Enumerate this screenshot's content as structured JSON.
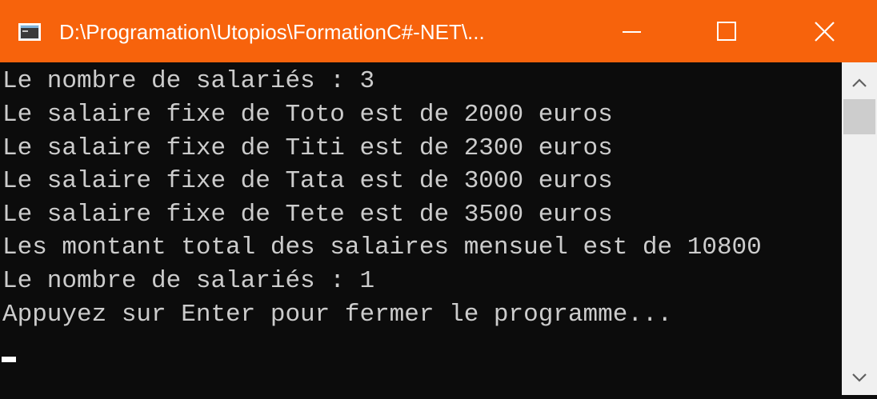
{
  "window": {
    "title": "D:\\Programation\\Utopios\\FormationC#-NET\\...",
    "icon": "console-app-icon",
    "accent_color": "#f7630c",
    "controls": {
      "minimize": "minimize-icon",
      "maximize": "maximize-icon",
      "close": "close-icon"
    }
  },
  "console": {
    "background": "#0c0c0c",
    "text_color": "#cccccc",
    "lines": [
      "Le nombre de salariés : 3",
      "Le salaire fixe de Toto est de 2000 euros",
      "Le salaire fixe de Titi est de 2300 euros",
      "Le salaire fixe de Tata est de 3000 euros",
      "Le salaire fixe de Tete est de 3500 euros",
      "Les montant total des salaires mensuel est de 10800",
      "Le nombre de salariés : 1",
      "Appuyez sur Enter pour fermer le programme..."
    ]
  },
  "scrollbar": {
    "up_icon": "chevron-up-icon",
    "down_icon": "chevron-down-icon"
  }
}
